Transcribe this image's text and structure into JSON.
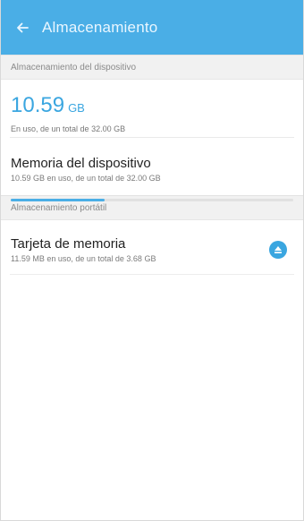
{
  "app_bar": {
    "title": "Almacenamiento"
  },
  "device_section": {
    "header": "Almacenamiento del dispositivo",
    "used_value": "10.59",
    "used_unit": "GB",
    "used_caption": "En uso, de un total de 32.00 GB"
  },
  "device_item": {
    "title": "Memoria del dispositivo",
    "subtitle": "10.59 GB en uso, de un total de 32.00 GB",
    "used_fraction": 0.331
  },
  "portable_section": {
    "header": "Almacenamiento portátil"
  },
  "card_item": {
    "title": "Tarjeta de memoria",
    "subtitle": "11.59 MB en uso, de un total de 3.68 GB"
  },
  "icons": {
    "back": "back-arrow-icon",
    "eject": "eject-icon"
  },
  "colors": {
    "accent": "#4aaee6",
    "accent_dark": "#3aa6e0"
  }
}
